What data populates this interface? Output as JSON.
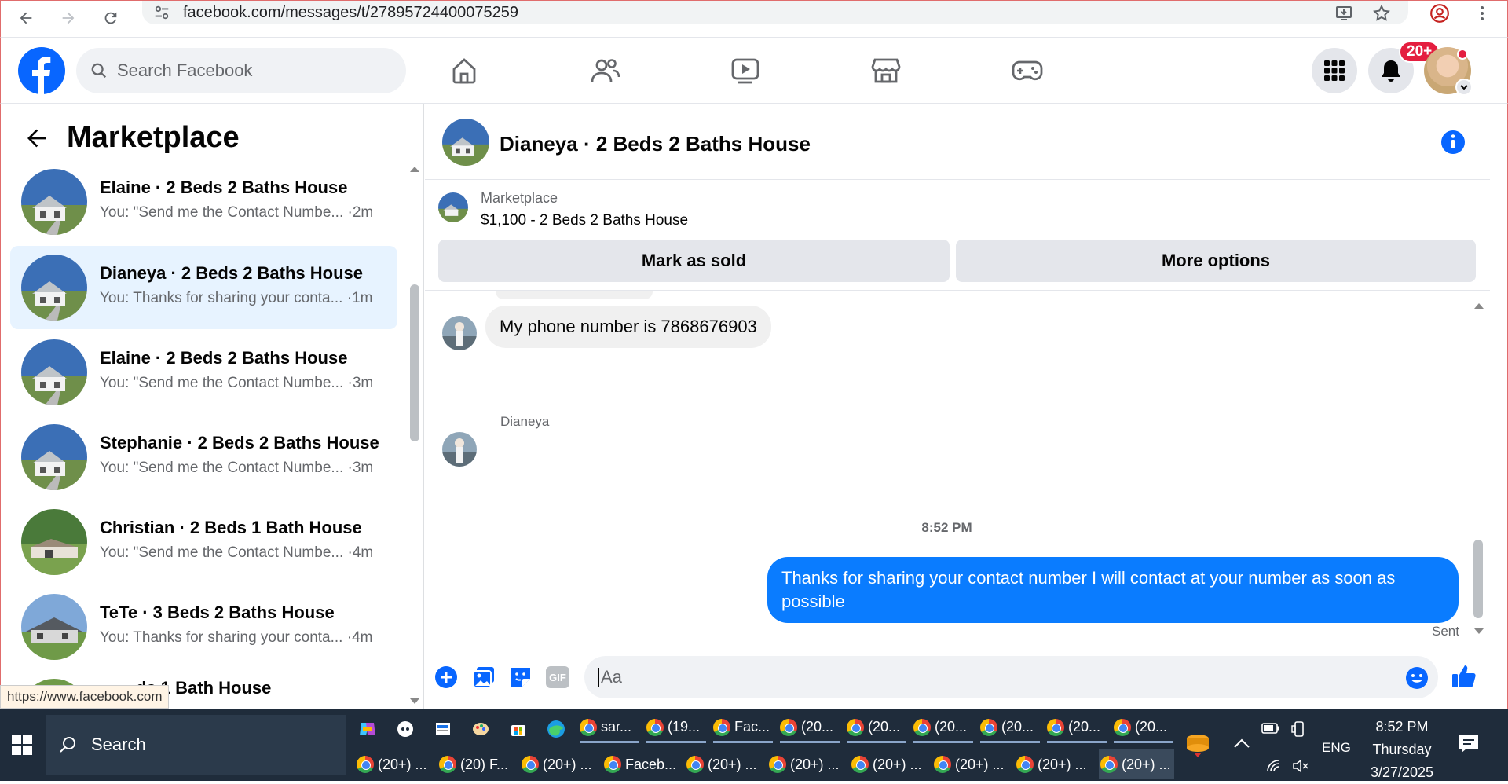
{
  "browser": {
    "url": "facebook.com/messages/t/27895724400075259",
    "status_url": "https://www.facebook.com"
  },
  "header": {
    "search_placeholder": "Search Facebook",
    "notification_badge": "20+"
  },
  "sidebar": {
    "title": "Marketplace",
    "conversations": [
      {
        "name": "Elaine · 2 Beds 2 Baths House",
        "preview": "You: \"Send me the Contact Numbe... ·2m",
        "active": false
      },
      {
        "name": "Dianeya · 2 Beds 2 Baths House",
        "preview": "You: Thanks for sharing your conta... ·1m",
        "active": true
      },
      {
        "name": "Elaine · 2 Beds 2 Baths House",
        "preview": "You: \"Send me the Contact Numbe... ·3m",
        "active": false
      },
      {
        "name": "Stephanie · 2 Beds 2 Baths House",
        "preview": "You: \"Send me the Contact Numbe... ·3m",
        "active": false
      },
      {
        "name": "Christian · 2 Beds 1 Bath House",
        "preview": "You: \"Send me the Contact Numbe... ·4m",
        "active": false
      },
      {
        "name": "TeTe · 3 Beds 2 Baths House",
        "preview": "You: Thanks for sharing your conta... ·4m",
        "active": false
      },
      {
        "name": "ds 1 Bath House",
        "preview": "",
        "active": false
      }
    ]
  },
  "chat": {
    "title": "Dianeya · 2 Beds 2 Baths House",
    "listing_source": "Marketplace",
    "listing": "$1,100 - 2 Beds 2 Baths House",
    "mark_sold_label": "Mark as sold",
    "more_options_label": "More options",
    "incoming_message": "My phone number is 7868676903",
    "sender_name": "Dianeya",
    "timestamp": "8:52 PM",
    "outgoing_message": "Thanks for sharing your contact number I will contact at your number as soon as possible",
    "sent_status": "Sent",
    "composer_placeholder": "Aa",
    "gif_label": "GIF"
  },
  "taskbar": {
    "search_placeholder": "Search",
    "row1_apps": [
      "sar...",
      "(19...",
      "Fac...",
      "(20...",
      "(20...",
      "(20...",
      "(20...",
      "(20...",
      "(20..."
    ],
    "row2_apps": [
      "(20+) ...",
      "(20) F...",
      "(20+) ...",
      "Faceb...",
      "(20+) ...",
      "(20+) ...",
      "(20+) ...",
      "(20+) ...",
      "(20+) ...",
      "(20+) ..."
    ],
    "language": "ENG",
    "time": "8:52 PM",
    "day": "Thursday",
    "date": "3/27/2025"
  },
  "colors": {
    "brand_blue": "#0866ff",
    "outgoing_bubble": "#0a7cff",
    "active_row": "#e7f3ff",
    "badge_red": "#e41e3f"
  }
}
